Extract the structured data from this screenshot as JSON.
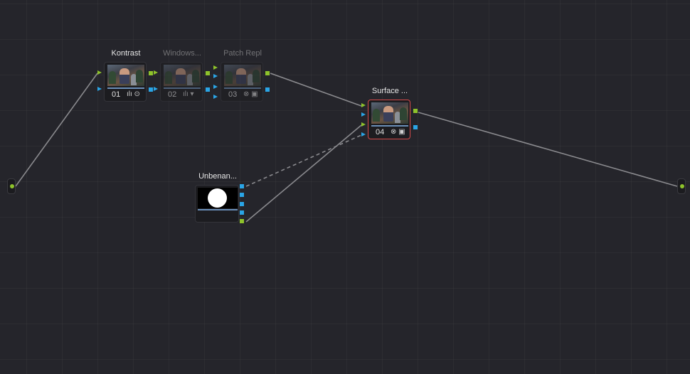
{
  "nodes": [
    {
      "id": "01",
      "title": "Kontrast",
      "icons": "ılı ⊙",
      "icon_names": [
        "curves-icon",
        "color-wheel-icon"
      ]
    },
    {
      "id": "02",
      "title": "Windows...",
      "icons": "ılı ▾",
      "icon_names": [
        "curves-icon",
        "window-icon"
      ]
    },
    {
      "id": "03",
      "title": "Patch Repl",
      "icons": "⊗ ▣",
      "icon_names": [
        "fx-icon",
        "key-icon"
      ]
    },
    {
      "id": "04",
      "title": "Surface ...",
      "icons": "⊗ ▣",
      "icon_names": [
        "fx-icon",
        "key-icon"
      ]
    }
  ],
  "mask_node": {
    "title": "Unbenan..."
  },
  "colors": {
    "background": "#25252b",
    "rgb_port": "#8ec22b",
    "alpha_port": "#2aa5e6",
    "selected_border": "#d64a4a",
    "wire": "#8a8a8e"
  }
}
